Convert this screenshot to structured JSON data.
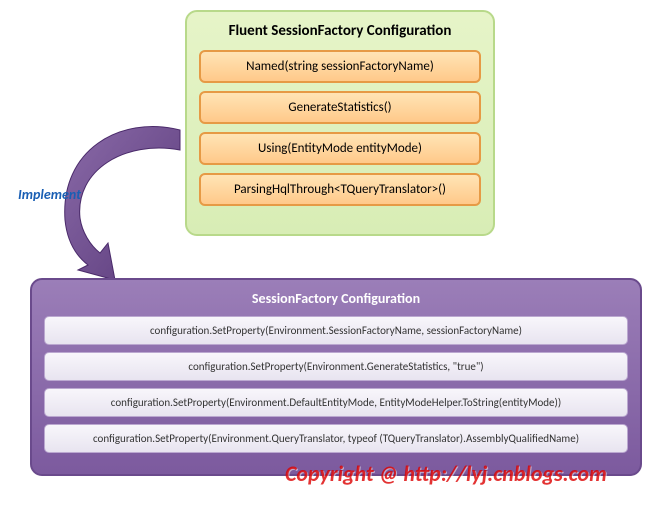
{
  "top": {
    "title": "Fluent SessionFactory  Configuration",
    "methods": [
      "Named(string sessionFactoryName)",
      "GenerateStatistics()",
      "Using(EntityMode entityMode)",
      "ParsingHqlThrough<TQueryTranslator>()"
    ]
  },
  "arrow_label": "Implement",
  "bottom": {
    "title": "SessionFactory  Configuration",
    "configs": [
      "configuration.SetProperty(Environment.SessionFactoryName, sessionFactoryName)",
      "configuration.SetProperty(Environment.GenerateStatistics, \"true\")",
      "configuration.SetProperty(Environment.DefaultEntityMode, EntityModeHelper.ToString(entityMode))",
      "configuration.SetProperty(Environment.QueryTranslator, typeof (TQueryTranslator).AssemblyQualifiedName)"
    ]
  },
  "watermark": "Copyright @ http://lyj.cnblogs.com"
}
